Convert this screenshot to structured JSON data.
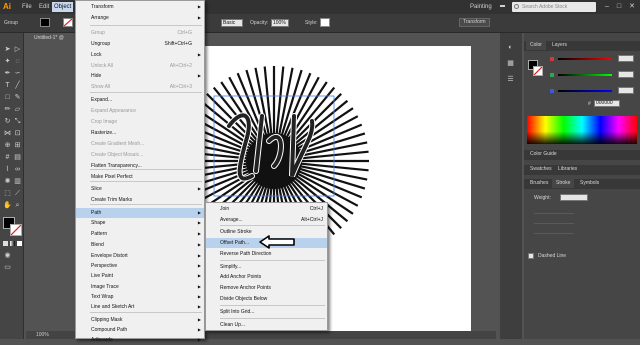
{
  "menubar": {
    "logo": "Ai",
    "items": [
      "File",
      "Edit",
      "Object"
    ],
    "workspace": "Painting",
    "search_placeholder": "Search Adobe Stock"
  },
  "control_bar": {
    "selection_label": "Group",
    "stroke_style": "Basic",
    "opacity_label": "Opacity:",
    "opacity_value": "100%",
    "style_label": "Style:",
    "transform_label": "Transform"
  },
  "document": {
    "tab_title": "Untitled-1* @",
    "zoom": "100%"
  },
  "object_menu": {
    "items": [
      {
        "label": "Transform",
        "shortcut": "",
        "submenu": true,
        "disabled": false
      },
      {
        "label": "Arrange",
        "shortcut": "",
        "submenu": true,
        "disabled": false
      },
      {
        "label": "Group",
        "shortcut": "Ctrl+G",
        "submenu": false,
        "disabled": true
      },
      {
        "label": "Ungroup",
        "shortcut": "Shift+Ctrl+G",
        "submenu": false,
        "disabled": false
      },
      {
        "label": "Lock",
        "shortcut": "",
        "submenu": true,
        "disabled": false
      },
      {
        "label": "Unlock All",
        "shortcut": "Alt+Ctrl+2",
        "submenu": false,
        "disabled": true
      },
      {
        "label": "Hide",
        "shortcut": "",
        "submenu": true,
        "disabled": false
      },
      {
        "label": "Show All",
        "shortcut": "Alt+Ctrl+3",
        "submenu": false,
        "disabled": true
      },
      {
        "label": "Expand...",
        "shortcut": "",
        "submenu": false,
        "disabled": false
      },
      {
        "label": "Expand Appearance",
        "shortcut": "",
        "submenu": false,
        "disabled": true
      },
      {
        "label": "Crop Image",
        "shortcut": "",
        "submenu": false,
        "disabled": true
      },
      {
        "label": "Rasterize...",
        "shortcut": "",
        "submenu": false,
        "disabled": false
      },
      {
        "label": "Create Gradient Mesh...",
        "shortcut": "",
        "submenu": false,
        "disabled": true
      },
      {
        "label": "Create Object Mosaic...",
        "shortcut": "",
        "submenu": false,
        "disabled": true
      },
      {
        "label": "Flatten Transparency...",
        "shortcut": "",
        "submenu": false,
        "disabled": false
      },
      {
        "label": "Make Pixel Perfect",
        "shortcut": "",
        "submenu": false,
        "disabled": false
      },
      {
        "label": "Slice",
        "shortcut": "",
        "submenu": true,
        "disabled": false
      },
      {
        "label": "Create Trim Marks",
        "shortcut": "",
        "submenu": false,
        "disabled": false
      },
      {
        "label": "Path",
        "shortcut": "",
        "submenu": true,
        "disabled": false,
        "highlighted": true
      },
      {
        "label": "Shape",
        "shortcut": "",
        "submenu": true,
        "disabled": false
      },
      {
        "label": "Pattern",
        "shortcut": "",
        "submenu": true,
        "disabled": false
      },
      {
        "label": "Blend",
        "shortcut": "",
        "submenu": true,
        "disabled": false
      },
      {
        "label": "Envelope Distort",
        "shortcut": "",
        "submenu": true,
        "disabled": false
      },
      {
        "label": "Perspective",
        "shortcut": "",
        "submenu": true,
        "disabled": false
      },
      {
        "label": "Live Paint",
        "shortcut": "",
        "submenu": true,
        "disabled": false
      },
      {
        "label": "Image Trace",
        "shortcut": "",
        "submenu": true,
        "disabled": false
      },
      {
        "label": "Text Wrap",
        "shortcut": "",
        "submenu": true,
        "disabled": false
      },
      {
        "label": "Line and Sketch Art",
        "shortcut": "",
        "submenu": true,
        "disabled": false
      },
      {
        "label": "Clipping Mask",
        "shortcut": "",
        "submenu": true,
        "disabled": false
      },
      {
        "label": "Compound Path",
        "shortcut": "",
        "submenu": true,
        "disabled": false
      },
      {
        "label": "Artboards",
        "shortcut": "",
        "submenu": true,
        "disabled": false
      }
    ]
  },
  "path_submenu": {
    "items": [
      {
        "label": "Join",
        "shortcut": "Ctrl+J"
      },
      {
        "label": "Average...",
        "shortcut": "Alt+Ctrl+J"
      },
      {
        "label": "Outline Stroke",
        "shortcut": ""
      },
      {
        "label": "Offset Path...",
        "shortcut": "",
        "highlighted": true
      },
      {
        "label": "Reverse Path Direction",
        "shortcut": ""
      },
      {
        "label": "Simplify...",
        "shortcut": ""
      },
      {
        "label": "Add Anchor Points",
        "shortcut": ""
      },
      {
        "label": "Remove Anchor Points",
        "shortcut": ""
      },
      {
        "label": "Divide Objects Below",
        "shortcut": ""
      },
      {
        "label": "Split Into Grid...",
        "shortcut": ""
      },
      {
        "label": "Clean Up...",
        "shortcut": ""
      }
    ]
  },
  "color_panel": {
    "tab_color": "Color",
    "tab_layers": "Layers",
    "hex_prefix": "#",
    "hex_value": "000000",
    "color_guide": "Color Guide",
    "swatches": "Swatches",
    "libraries": "Libraries",
    "brushes": "Brushes",
    "stroke": "Stroke",
    "symbols": "Symbols",
    "weight_label": "Weight:",
    "dashed_line": "Dashed Line"
  },
  "colors": {
    "accent": "#b8d2ee",
    "red_slider": "#d23a3a",
    "green_slider": "#2fa84a",
    "blue_slider": "#3a5ad6",
    "arrow_annotation": "#000000"
  }
}
